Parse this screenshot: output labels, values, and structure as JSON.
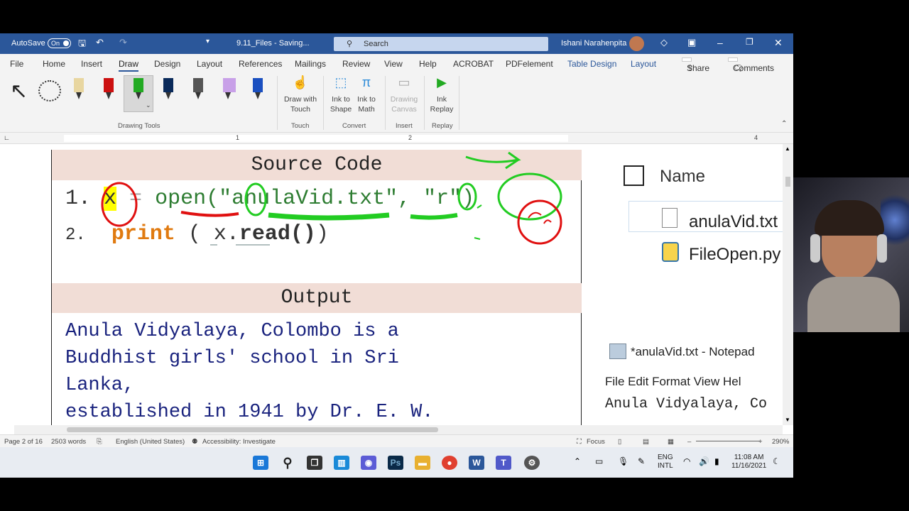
{
  "titlebar": {
    "autosave_label": "AutoSave",
    "autosave_state": "On",
    "doc_name": "9.11_Files  -  Saving...",
    "search_placeholder": "Search",
    "user_name": "Ishani Narahenpita"
  },
  "menu": [
    "File",
    "Home",
    "Insert",
    "Draw",
    "Design",
    "Layout",
    "References",
    "Mailings",
    "Review",
    "View",
    "Help",
    "ACROBAT",
    "PDFelement",
    "Table Design",
    "Layout"
  ],
  "menu_share": "Share",
  "menu_comments": "Comments",
  "ribbon": {
    "draw_with_touch": [
      "Draw with",
      "Touch"
    ],
    "ink_to_shape": [
      "Ink to",
      "Shape"
    ],
    "ink_to_math": [
      "Ink to",
      "Math"
    ],
    "drawing_canvas": [
      "Drawing",
      "Canvas"
    ],
    "ink_replay": [
      "Ink",
      "Replay"
    ],
    "groups": {
      "drawing_tools": "Drawing Tools",
      "touch": "Touch",
      "convert": "Convert",
      "insert": "Insert",
      "replay": "Replay"
    },
    "pen_colors": [
      "#e8d6a0",
      "#cc1010",
      "#22aa22",
      "#0a2a5a",
      "#555555",
      "#9040c0",
      "#1a4fc0"
    ]
  },
  "ruler": {
    "marks": [
      "1",
      "2",
      "4"
    ]
  },
  "doc": {
    "source_header": "Source Code",
    "line1_num": "1.",
    "line1_var": "x",
    "line1_eq": " = ",
    "line1_fn": "open",
    "line1_rest": "(\"anulaVid.txt\", \"r\")",
    "line2_num": "2.",
    "line2_fn": "print",
    "line2_rest": " ( x.",
    "line2_call": "read()",
    "line2_end": ")",
    "output_header": "Output",
    "output_lines": [
      "Anula Vidyalaya, Colombo is a",
      "Buddhist girls' school in Sri",
      "Lanka,",
      "established in 1941 by Dr. E. W."
    ]
  },
  "explorer": {
    "column_header": "Name",
    "files": [
      "anulaVid.txt",
      "FileOpen.py"
    ]
  },
  "notepad": {
    "title": "*anulaVid.txt - Notepad",
    "menu": "File  Edit  Format  View  Hel",
    "content": "Anula Vidyalaya, Co"
  },
  "status": {
    "page": "Page 2 of 16",
    "words": "2503 words",
    "language": "English (United States)",
    "accessibility": "Accessibility: Investigate",
    "focus": "Focus",
    "zoom": "290%"
  },
  "tray": {
    "lang1": "ENG",
    "lang2": "INTL",
    "time": "11:08 AM",
    "date": "11/16/2021"
  }
}
